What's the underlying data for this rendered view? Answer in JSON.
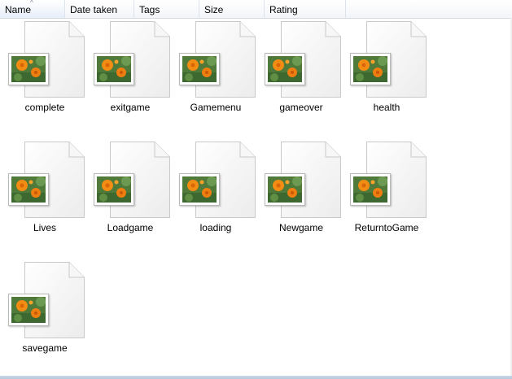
{
  "columns": [
    "Name",
    "Date taken",
    "Tags",
    "Size",
    "Rating"
  ],
  "sort": {
    "column": "Name",
    "indicator": "^"
  },
  "files": [
    {
      "name": "complete",
      "icon": "image-file-icon"
    },
    {
      "name": "exitgame",
      "icon": "image-file-icon"
    },
    {
      "name": "Gamemenu",
      "icon": "image-file-icon"
    },
    {
      "name": "gameover",
      "icon": "image-file-icon"
    },
    {
      "name": "health",
      "icon": "image-file-icon"
    },
    {
      "name": "Lives",
      "icon": "image-file-icon"
    },
    {
      "name": "Loadgame",
      "icon": "image-file-icon"
    },
    {
      "name": "loading",
      "icon": "image-file-icon"
    },
    {
      "name": "Newgame",
      "icon": "image-file-icon"
    },
    {
      "name": "ReturntoGame",
      "icon": "image-file-icon"
    },
    {
      "name": "savegame",
      "icon": "image-file-icon"
    }
  ],
  "colors": {
    "header_border": "#d5dbe4",
    "window_bg": "#ffffff",
    "thumb_bg": "#4f7a3a",
    "flower": "#f28c12"
  }
}
